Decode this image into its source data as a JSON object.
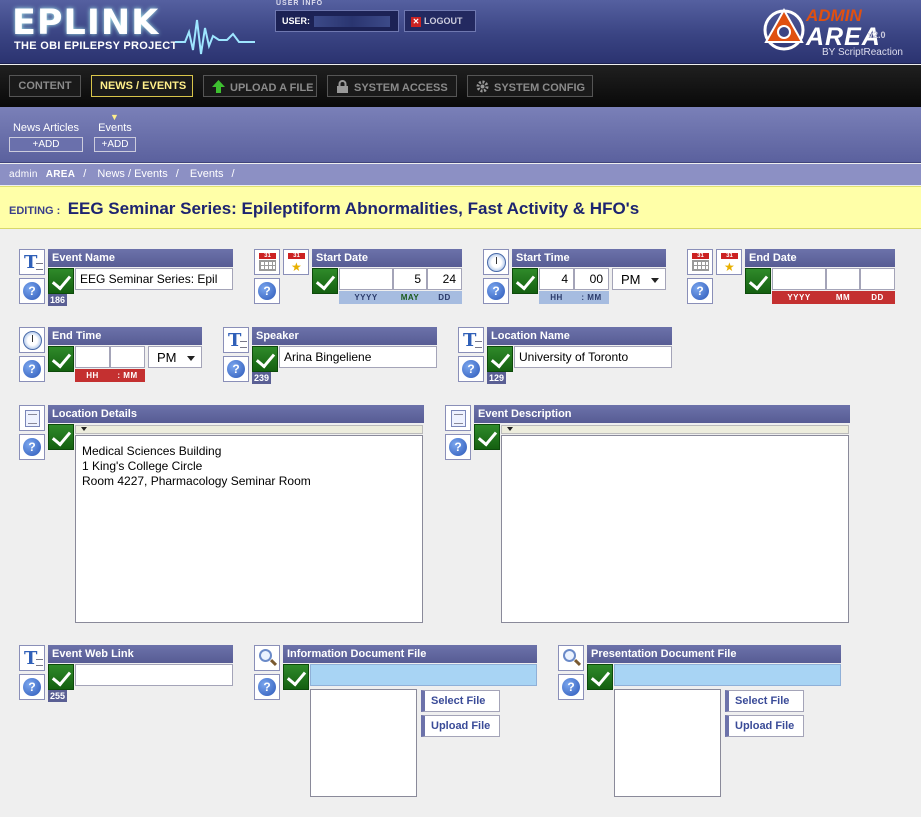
{
  "header": {
    "logo_main": "EPLINK",
    "logo_sub": "THE OBI EPILEPSY PROJECT",
    "userinfo_label": "USER INFO",
    "user_label": "USER:",
    "logout_label": "LOGOUT",
    "admin_top": "ADMIN",
    "admin_bottom": "AREA",
    "admin_version": "v2.0",
    "admin_by": "BY ScriptReaction"
  },
  "nav": {
    "content": "CONTENT",
    "news_events": "NEWS / EVENTS",
    "upload": "UPLOAD A FILE",
    "access": "SYSTEM ACCESS",
    "config": "SYSTEM CONFIG"
  },
  "subnav": {
    "news_articles": "News Articles",
    "events": "Events",
    "add": "+ADD"
  },
  "breadcrumb": {
    "admin_prefix": "admin",
    "admin_bold": "AREA",
    "sep": "/",
    "news": "News / Events",
    "events": "Events"
  },
  "editing": {
    "label": "EDITING :",
    "title": "EEG Seminar Series: Epileptiform Abnormalities, Fast Activity & HFO's"
  },
  "fields": {
    "event_name": {
      "label": "Event Name",
      "value": "EEG Seminar Series: Epil",
      "counter": "186"
    },
    "start_date": {
      "label": "Start Date",
      "year": "",
      "month": "5",
      "day": "24",
      "yyyy": "YYYY",
      "mm": "MAY",
      "dd": "DD"
    },
    "start_time": {
      "label": "Start Time",
      "hh": "4",
      "mm": "00",
      "ampm": "PM",
      "hh_lbl": "HH",
      "mm_lbl": ": MM"
    },
    "end_date": {
      "label": "End Date",
      "year": "",
      "month": "",
      "day": "",
      "yyyy": "YYYY",
      "mm": "MM",
      "dd": "DD"
    },
    "end_time": {
      "label": "End Time",
      "hh": "",
      "mm": "",
      "ampm": "PM",
      "hh_lbl": "HH",
      "mm_lbl": ": MM"
    },
    "speaker": {
      "label": "Speaker",
      "value": "Arina Bingeliene",
      "counter": "239"
    },
    "location_name": {
      "label": "Location Name",
      "value": "University of Toronto",
      "counter": "129"
    },
    "location_details": {
      "label": "Location Details",
      "value": "Medical Sciences Building\n1 King's College Circle\nRoom 4227, Pharmacology Seminar Room"
    },
    "event_description": {
      "label": "Event Description",
      "value": ""
    },
    "event_web_link": {
      "label": "Event Web Link",
      "value": "",
      "counter": "255"
    },
    "info_doc": {
      "label": "Information Document File",
      "select": "Select File",
      "upload": "Upload File"
    },
    "pres_doc": {
      "label": "Presentation Document File",
      "select": "Select File",
      "upload": "Upload File"
    }
  },
  "icons": {
    "text": "T",
    "calendar": "31",
    "calendar_star": "★",
    "help": "?"
  },
  "colors": {
    "header_bg": "#3a4483",
    "nav_active": "#ffef8a",
    "label_bg": "#6c72aa",
    "check_green": "#2f8a2a",
    "editing_bg": "#ffffa8",
    "date_blue": "#a6bce0",
    "date_red": "#c43030"
  }
}
